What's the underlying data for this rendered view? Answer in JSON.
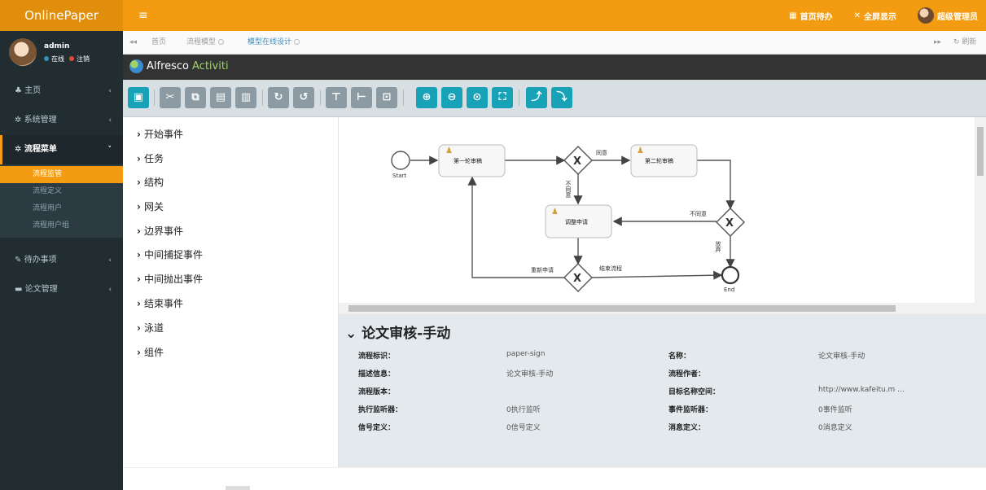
{
  "app": {
    "brand": "OnlinePaper",
    "menu_icon": "≡"
  },
  "topbar": {
    "items": [
      {
        "icon": "calendar-icon",
        "label": "首页待办"
      },
      {
        "icon": "fullscreen-icon",
        "label": "全屏显示"
      },
      {
        "icon": "avatar",
        "label": "超级管理员"
      }
    ]
  },
  "user": {
    "name": "admin",
    "online": "在线",
    "logout": "注销",
    "online_color": "#3c8dbc",
    "logout_color": "#dd4b39"
  },
  "sidebar": {
    "items": [
      {
        "label": "主页",
        "icon": "home-icon"
      },
      {
        "label": "系统管理",
        "icon": "gear-icon"
      },
      {
        "label": "流程菜单",
        "icon": "cogs-icon",
        "open": true
      },
      {
        "label": "待办事项",
        "icon": "pencil-icon"
      },
      {
        "label": "论文管理",
        "icon": "folder-icon"
      }
    ],
    "submenu": [
      "流程监管",
      "流程定义",
      "流程用户",
      "流程用户组"
    ],
    "active_sub": "流程监管"
  },
  "tabs": {
    "home": "首页",
    "t1": "流程模型",
    "t2": "模型在线设计",
    "refresh": "刷新"
  },
  "activiti": {
    "part1": "Alfresco",
    "part2": "Activiti"
  },
  "toolbar": {
    "buttons": [
      "save-icon",
      "cut-icon",
      "copy-icon",
      "paste-icon",
      "delete-icon",
      "redo-icon",
      "undo-icon",
      "align-vertical-icon",
      "align-horizontal-icon",
      "same-size-icon",
      "zoom-in-icon",
      "zoom-out-icon",
      "zoom-actual-icon",
      "zoom-fit-icon",
      "bendpoint-add-icon",
      "bendpoint-remove-icon"
    ]
  },
  "palette": [
    "开始事件",
    "任务",
    "结构",
    "网关",
    "边界事件",
    "中间捕捉事件",
    "中间抛出事件",
    "结束事件",
    "泳道",
    "组件"
  ],
  "diagram": {
    "start_label": "Start",
    "end_label": "End",
    "task1": "第一轮审稿",
    "task2": "第二轮审稿",
    "task3": "调整申请",
    "agree": "同意",
    "disagree_v": "不同意",
    "disagree": "不同意",
    "reapply": "重新申请",
    "end_flow": "结束流程",
    "abandon": "放弃"
  },
  "properties": {
    "title": "论文审核-手动",
    "rows": [
      {
        "l1": "流程标识：",
        "v1": "paper-sign",
        "l2": "名称：",
        "v2": "论文审核-手动"
      },
      {
        "l1": "描述信息：",
        "v1": "论文审核-手动",
        "l2": "流程作者：",
        "v2": ""
      },
      {
        "l1": "流程版本：",
        "v1": "",
        "l2": "目标名称空间：",
        "v2": "http://www.kafeitu.m ..."
      },
      {
        "l1": "执行监听器：",
        "v1": "0执行监听",
        "l2": "事件监听器：",
        "v2": "0事件监听"
      },
      {
        "l1": "信号定义：",
        "v1": "0信号定义",
        "l2": "消息定义：",
        "v2": "0消息定义"
      }
    ]
  },
  "colors": {
    "orange": "#f39c12",
    "sidebar": "#222d32",
    "teal": "#18a2b8",
    "grey_btn": "#8b9aa3"
  }
}
